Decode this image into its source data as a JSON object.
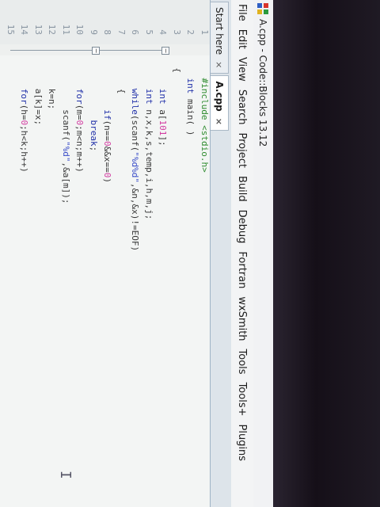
{
  "window": {
    "title": "A.cpp - Code::Blocks 13.12",
    "app_icon": "codeblocks-icon"
  },
  "menu": [
    "File",
    "Edit",
    "View",
    "Search",
    "Project",
    "Build",
    "Debug",
    "Fortran",
    "wxSmith",
    "Tools",
    "Tools+",
    "Plugins"
  ],
  "tabs": [
    {
      "label": "Start here",
      "close": "×",
      "active": false
    },
    {
      "label": "A.cpp",
      "close": "×",
      "active": true
    }
  ],
  "editor": {
    "lines": [
      {
        "num": "1",
        "text": "    #include <stdio.h>"
      },
      {
        "num": "2",
        "text": "    int main( )"
      },
      {
        "num": "3",
        "text": "  {"
      },
      {
        "num": "4",
        "text": "      int a[101];"
      },
      {
        "num": "5",
        "text": "      int n,x,k,s,temp,i,h,m,j;"
      },
      {
        "num": "6",
        "text": "      while(scanf(\"%d%d\",&n,&x)!=EOF)"
      },
      {
        "num": "7",
        "text": "      {"
      },
      {
        "num": "8",
        "text": "          if(n==0&&x==0)"
      },
      {
        "num": "9",
        "text": "            break;"
      },
      {
        "num": "10",
        "text": "      for(m=0;m<n;m++)"
      },
      {
        "num": "11",
        "text": "          scanf(\"%d\",&a[m]);"
      },
      {
        "num": "12",
        "text": "      k=n;"
      },
      {
        "num": "13",
        "text": "      a[k]=x;"
      },
      {
        "num": "14",
        "text": "      for(h=0;h<k;h++)"
      },
      {
        "num": "15",
        "text": ""
      }
    ]
  },
  "colors": {
    "preprocessor": "#2e8b2e",
    "keyword": "#1f2fa8",
    "string": "#3c4fc9",
    "number": "#d23aa0"
  }
}
